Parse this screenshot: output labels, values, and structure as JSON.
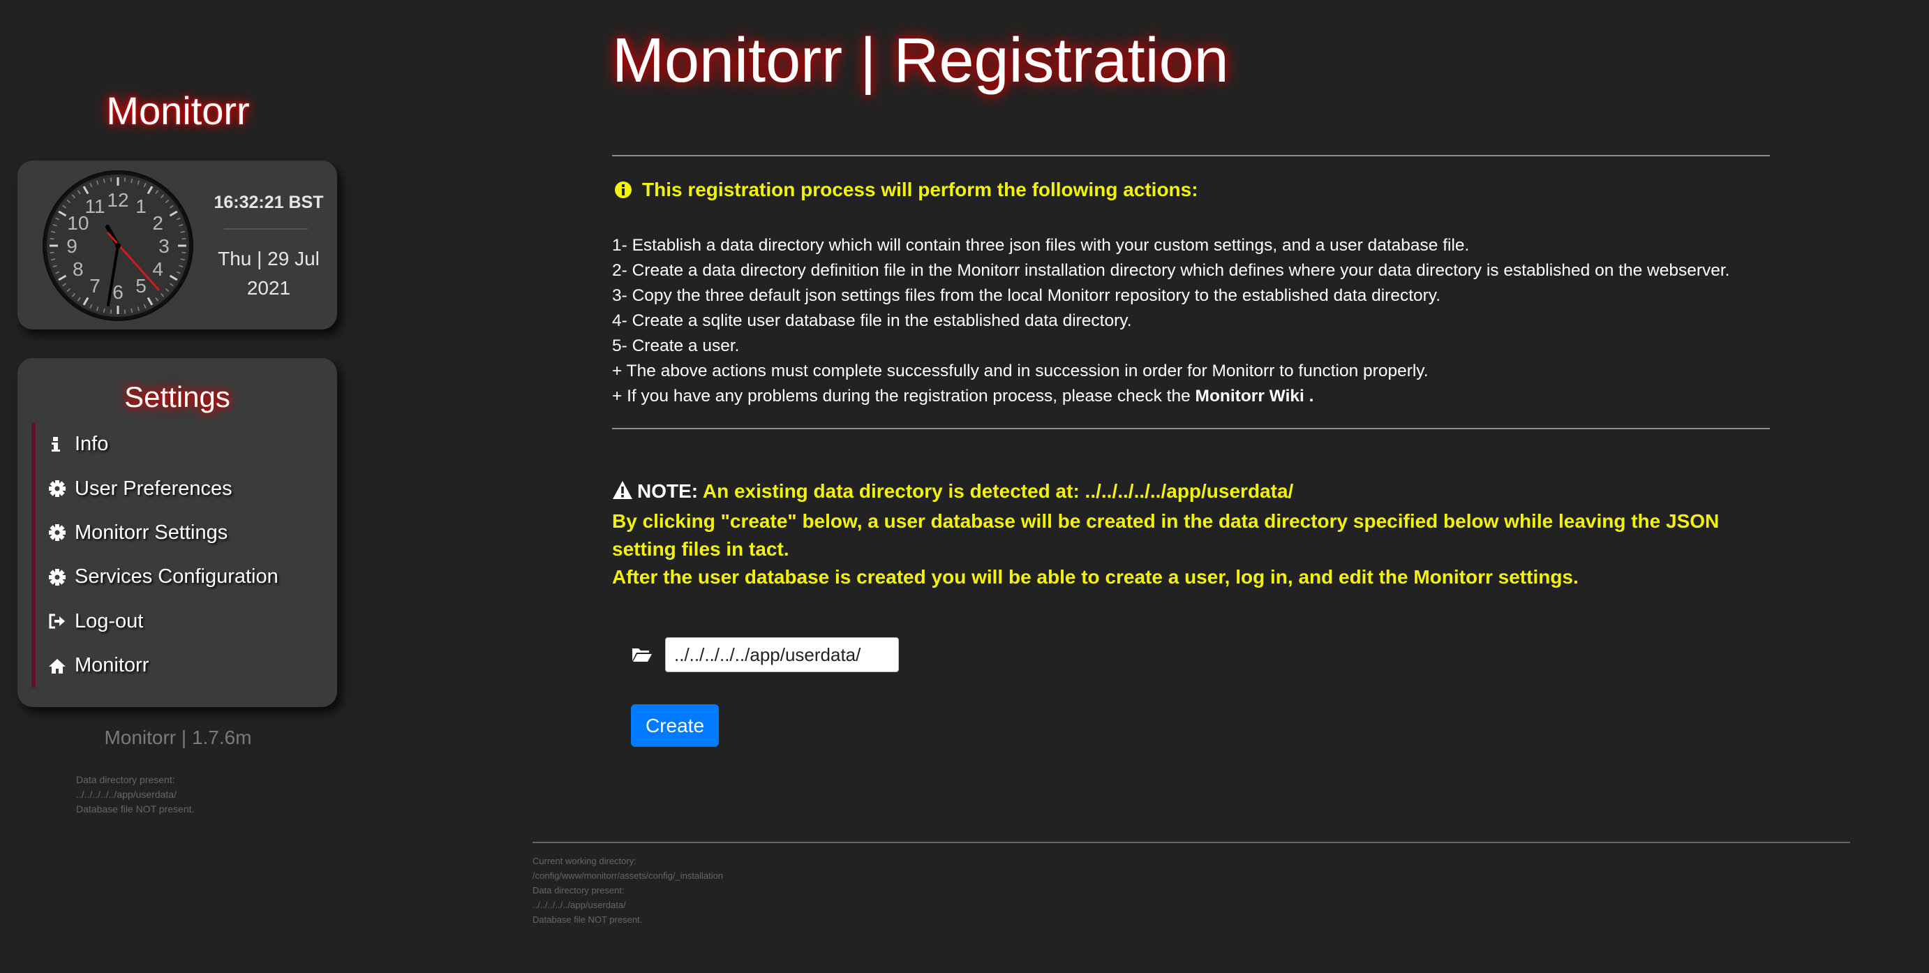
{
  "sidebar": {
    "brand": "Monitorr",
    "clock": {
      "time": "16:32:21 BST",
      "date_line1": "Thu | 29 Jul",
      "date_line2": "2021",
      "hours": [
        "12",
        "1",
        "2",
        "3",
        "4",
        "5",
        "6",
        "7",
        "8",
        "9",
        "10",
        "11"
      ]
    },
    "settings": {
      "title": "Settings",
      "items": [
        {
          "label": "Info",
          "icon": "info-icon"
        },
        {
          "label": "User Preferences",
          "icon": "gear-icon"
        },
        {
          "label": "Monitorr Settings",
          "icon": "gear-icon"
        },
        {
          "label": "Services Configuration",
          "icon": "gear-icon"
        },
        {
          "label": "Log-out",
          "icon": "sign-out-icon"
        },
        {
          "label": "Monitorr",
          "icon": "home-icon"
        }
      ]
    },
    "version": "Monitorr | 1.7.6m",
    "info_lines": [
      "Data directory present:",
      "../../../../../app/userdata/",
      "Database file NOT present."
    ]
  },
  "main": {
    "title": "Monitorr | Registration",
    "info_heading": "This registration process will perform the following actions:",
    "actions": [
      "1- Establish a data directory which will contain three json files with your custom settings, and a user database file.",
      "2- Create a data directory definition file in the Monitorr installation directory which defines where your data directory is established on the webserver.",
      "3- Copy the three default json settings files from the local Monitorr repository to the established data directory.",
      "4- Create a sqlite user database file in the established data directory.",
      "5- Create a user.",
      "+ The above actions must complete successfully and in succession in order for Monitorr to function properly."
    ],
    "wiki_prefix": "+ If you have any problems during the registration process, please check the",
    "wiki_link": "Monitorr Wiki .",
    "note": {
      "label": "NOTE:",
      "line1": "An existing data directory is detected at: ../../../../../app/userdata/",
      "line2": "By clicking \"create\" below, a user database will be created in the data directory specified below while leaving the JSON setting files in tact.",
      "line3": "After the user database is created you will be able to create a user, log in, and edit the Monitorr settings."
    },
    "directory_value": "../../../../../app/userdata/",
    "create_label": "Create"
  },
  "footer": {
    "lines": [
      "Current working directory:",
      "/config/www/monitorr/assets/config/_installation",
      "Data directory present:",
      "../../../../../app/userdata/",
      "Database file NOT present."
    ]
  },
  "colors": {
    "background": "#222222",
    "panel": "#3b3b3b",
    "accent_yellow": "#f2f20a",
    "button_blue": "#007bff",
    "glow_red": "#ff0000",
    "menu_bar": "#5e1328"
  }
}
